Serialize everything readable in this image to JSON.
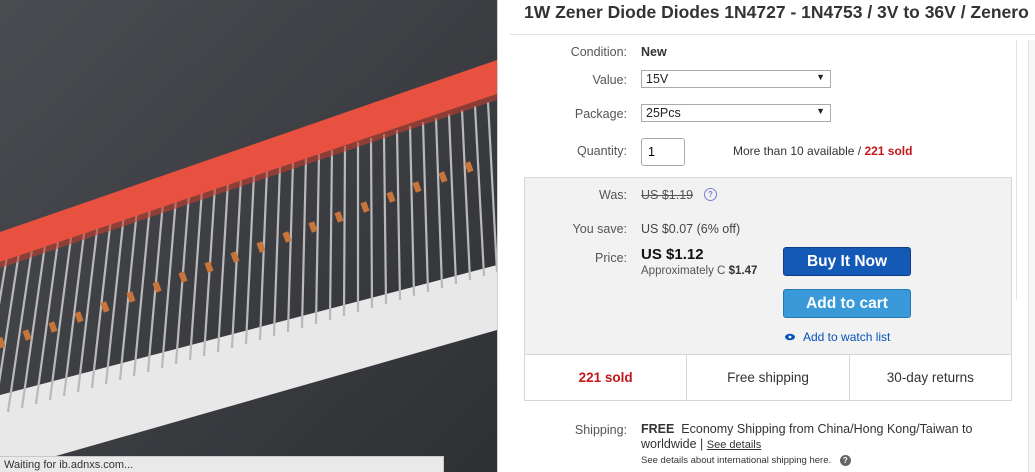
{
  "product": {
    "title": "1W Zener Diode Diodes 1N4727 - 1N4753 / 3V to 36V / Zenero"
  },
  "condition": {
    "label": "Condition:",
    "value": "New"
  },
  "value_select": {
    "label": "Value:",
    "selected": "15V"
  },
  "package_select": {
    "label": "Package:",
    "selected": "25Pcs"
  },
  "quantity": {
    "label": "Quantity:",
    "value": "1",
    "availability": "More than 10 available /",
    "sold": "221 sold"
  },
  "pricing": {
    "was_label": "Was:",
    "was_value": "US $1.19",
    "save_label": "You save:",
    "save_value": "US $0.07 (6% off)",
    "price_label": "Price:",
    "price_value": "US $1.12",
    "approx_prefix": "Approximately C",
    "approx_value": "$1.47"
  },
  "actions": {
    "buy_now": "Buy It Now",
    "add_to_cart": "Add to cart",
    "watch": "Add to watch list"
  },
  "strip": {
    "sold": "221 sold",
    "shipping": "Free shipping",
    "returns": "30-day returns"
  },
  "shipping": {
    "label": "Shipping:",
    "free": "FREE",
    "line1": "Economy Shipping from China/Hong Kong/Taiwan to",
    "line2": "worldwide |",
    "see_details": "See details",
    "line3": "See details about international shipping here."
  },
  "status_bar": {
    "text": "Waiting for ib.adnxs.com..."
  },
  "colors": {
    "buy_button": "#1559b7",
    "cart_button": "#3a9ad9",
    "sold_red": "#c4171c",
    "link_blue": "#0654ba",
    "tape_red": "#e8503f"
  },
  "icons": {
    "info": "info-circle-icon",
    "eye": "eye-icon",
    "help": "question-circle-icon",
    "chevron": "chevron-down-icon"
  }
}
